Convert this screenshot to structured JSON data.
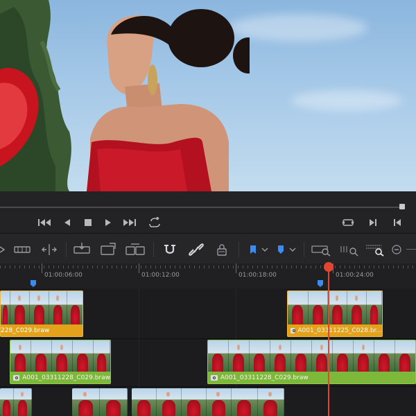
{
  "ruler": {
    "timecodes": [
      "01:00:06:00",
      "01:00:12:00",
      "01:00:18:00",
      "01:00:24:00"
    ]
  },
  "clips": {
    "v3_left_label": "228_C029.braw",
    "v3_right_label": "A001_03311225_C028.br...",
    "v2_left_label": "A001_03311228_C029.braw",
    "v2_right_label": "A001_03311228_C029.braw"
  },
  "colors": {
    "clip_orange": "#e3a21a",
    "clip_green": "#7db83a",
    "playhead": "#e3452f",
    "marker_blue": "#3b8cf0"
  },
  "icons": {
    "transport": [
      "skip-to-start-icon",
      "play-reverse-icon",
      "stop-icon",
      "play-icon",
      "skip-to-end-icon",
      "loop-icon"
    ],
    "transport_right": [
      "match-frame-icon",
      "mark-in-icon",
      "mark-out-icon"
    ],
    "toolbar": [
      "trim-icon",
      "blade-icon",
      "dynamic-trim-icon",
      "insert-clip-icon",
      "overwrite-clip-icon",
      "replace-clip-icon",
      "snapping-icon",
      "linked-selection-icon",
      "position-lock-icon",
      "flag-icon",
      "marker-icon",
      "zoom-full-icon",
      "zoom-detail-icon",
      "zoom-custom-icon",
      "zoom-out-icon"
    ]
  }
}
